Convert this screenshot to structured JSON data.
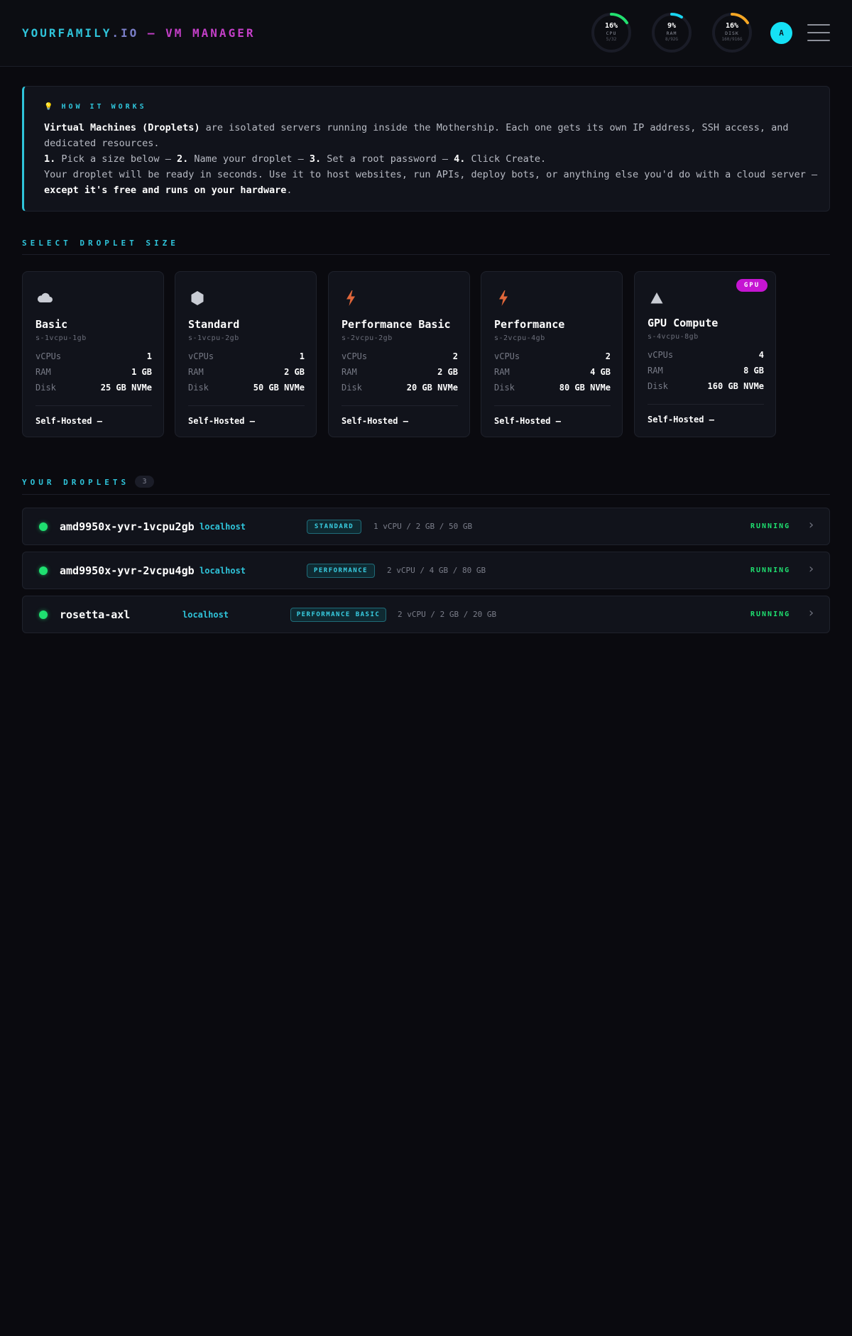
{
  "header": {
    "brand_part1": "YOURFAMILY",
    "brand_part2": ".IO",
    "brand_part3": " — VM MANAGER",
    "avatar_initial": "A",
    "gauges": [
      {
        "pct_label": "16%",
        "label": "CPU",
        "sub": "5/32",
        "fraction": 0.16,
        "color": "#22e06f"
      },
      {
        "pct_label": "9%",
        "label": "RAM",
        "sub": "8/92G",
        "fraction": 0.09,
        "color": "#19d4f0"
      },
      {
        "pct_label": "16%",
        "label": "DISK",
        "sub": "160/916G",
        "fraction": 0.16,
        "color": "#f5a623"
      }
    ]
  },
  "info": {
    "icon": "lightbulb-icon",
    "title": "HOW IT WORKS",
    "line1_bold": "Virtual Machines (Droplets)",
    "line1_rest": " are isolated servers running inside the Mothership. Each one gets its own IP address, SSH access, and dedicated resources.",
    "step1_num": "1.",
    "step1_text": " Pick a size below — ",
    "step2_num": "2.",
    "step2_text": " Name your droplet — ",
    "step3_num": "3.",
    "step3_text": " Set a root password — ",
    "step4_num": "4.",
    "step4_text": " Click Create.",
    "line3_rest": "Your droplet will be ready in seconds. Use it to host websites, run APIs, deploy bots, or anything else you'd do with a cloud server — ",
    "line3_bold": "except it's free and runs on your hardware",
    "line3_end": "."
  },
  "sizes_section": {
    "title": "SELECT DROPLET SIZE"
  },
  "sizes": [
    {
      "name": "Basic",
      "slug": "s-1vcpu-1gb",
      "icon": "cloud-icon",
      "vcpus_label": "vCPUs",
      "vcpus": "1",
      "ram_label": "RAM",
      "ram": "1 GB",
      "disk_label": "Disk",
      "disk": "25 GB NVMe",
      "price": "Self-Hosted —"
    },
    {
      "name": "Standard",
      "slug": "s-1vcpu-2gb",
      "icon": "hexagon-icon",
      "vcpus_label": "vCPUs",
      "vcpus": "1",
      "ram_label": "RAM",
      "ram": "2 GB",
      "disk_label": "Disk",
      "disk": "50 GB NVMe",
      "price": "Self-Hosted —"
    },
    {
      "name": "Performance Basic",
      "slug": "s-2vcpu-2gb",
      "icon": "lightning-icon",
      "vcpus_label": "vCPUs",
      "vcpus": "2",
      "ram_label": "RAM",
      "ram": "2 GB",
      "disk_label": "Disk",
      "disk": "20 GB NVMe",
      "price": "Self-Hosted —"
    },
    {
      "name": "Performance",
      "slug": "s-2vcpu-4gb",
      "icon": "lightning-icon",
      "vcpus_label": "vCPUs",
      "vcpus": "2",
      "ram_label": "RAM",
      "ram": "4 GB",
      "disk_label": "Disk",
      "disk": "80 GB NVMe",
      "price": "Self-Hosted —"
    },
    {
      "name": "GPU Compute",
      "slug": "s-4vcpu-8gb",
      "icon": "triangle-icon",
      "badge": "GPU",
      "vcpus_label": "vCPUs",
      "vcpus": "4",
      "ram_label": "RAM",
      "ram": "8 GB",
      "disk_label": "Disk",
      "disk": "160 GB NVMe",
      "price": "Self-Hosted —"
    }
  ],
  "droplets_section": {
    "title": "YOUR DROPLETS",
    "count": "3"
  },
  "droplets": [
    {
      "name": "amd9950x-yvr-1vcpu2gb",
      "host": "localhost",
      "type": "STANDARD",
      "spec": "1 vCPU / 2 GB / 50 GB",
      "status": "RUNNING",
      "status_color": "#1fe070"
    },
    {
      "name": "amd9950x-yvr-2vcpu4gb",
      "host": "localhost",
      "type": "PERFORMANCE",
      "spec": "2 vCPU / 4 GB / 80 GB",
      "status": "RUNNING",
      "status_color": "#1fe070"
    },
    {
      "name": "rosetta-axl",
      "host": "localhost",
      "type": "PERFORMANCE BASIC",
      "spec": "2 vCPU / 2 GB / 20 GB",
      "status": "RUNNING",
      "status_color": "#1fe070"
    }
  ]
}
